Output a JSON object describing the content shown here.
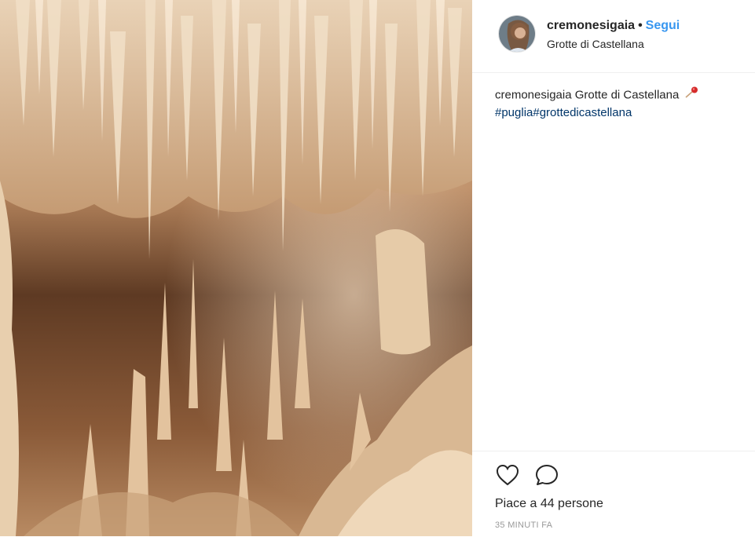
{
  "post": {
    "username": "cremonesigaia",
    "separator": "•",
    "follow_label": "Segui",
    "location": "Grotte di Castellana",
    "caption_user": "cremonesigaia",
    "caption_text": " Grotte di Castellana",
    "caption_hashtags": "#puglia#grottedicastellana",
    "likes_text": "Piace a 44 persone",
    "timestamp": "35 MINUTI FA"
  },
  "icons": {
    "like": "heart-outline-icon",
    "comment": "speech-bubble-icon",
    "location_pin": "red-pin-icon"
  },
  "colors": {
    "follow": "#3897f0",
    "hashtag": "#003569",
    "muted": "#999999",
    "text": "#262626"
  }
}
